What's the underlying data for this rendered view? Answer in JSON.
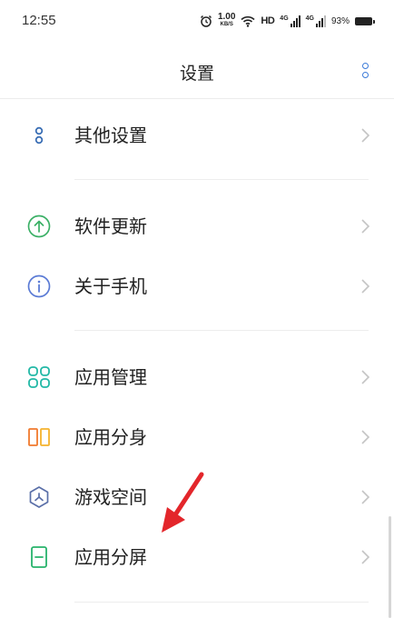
{
  "status_bar": {
    "time": "12:55",
    "net_speed_value": "1.00",
    "net_speed_unit": "KB/S",
    "hd": "HD",
    "network_1": "4G",
    "network_2": "4G",
    "battery": "93%",
    "icons": [
      "alarm-icon",
      "wifi-icon",
      "signal-icon",
      "signal-icon",
      "battery-icon"
    ]
  },
  "header": {
    "title": "设置",
    "menu_icon": "more-vertical-icon",
    "accent": "#3b7ad9"
  },
  "items": [
    {
      "label": "其他设置",
      "icon": "more-dots-icon",
      "color": "#3b6fb5"
    },
    {
      "label": "软件更新",
      "icon": "update-arrow-icon",
      "color": "#3bb066"
    },
    {
      "label": "关于手机",
      "icon": "info-icon",
      "color": "#5b7bd5"
    },
    {
      "label": "应用管理",
      "icon": "grid-apps-icon",
      "color": "#22b8a6"
    },
    {
      "label": "应用分身",
      "icon": "dual-apps-icon",
      "color": "#f07a2e"
    },
    {
      "label": "游戏空间",
      "icon": "game-space-icon",
      "color": "#5a6fa8"
    },
    {
      "label": "应用分屏",
      "icon": "split-screen-icon",
      "color": "#27b36b"
    }
  ],
  "annotation": {
    "icon": "red-arrow-icon",
    "color": "#e3262b"
  }
}
